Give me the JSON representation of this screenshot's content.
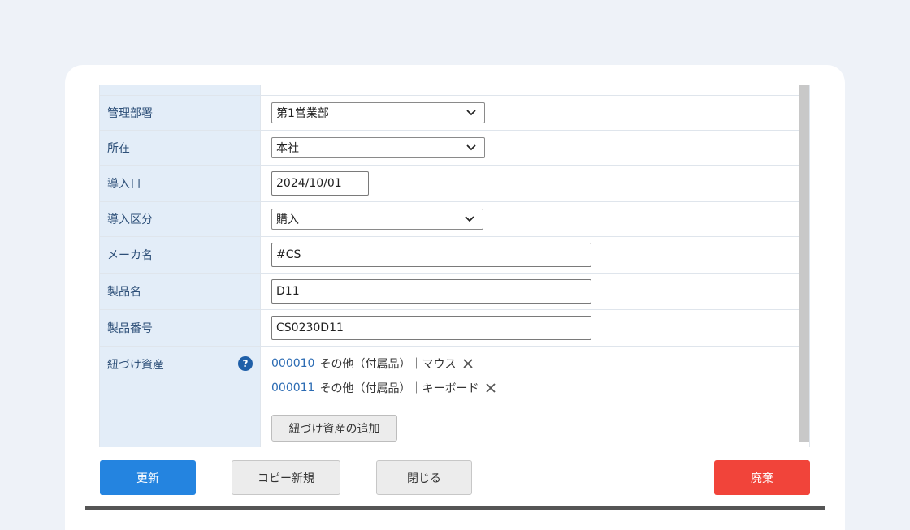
{
  "form": {
    "department": {
      "label": "管理部署",
      "value": "第1営業部"
    },
    "location": {
      "label": "所在",
      "value": "本社"
    },
    "intro_date": {
      "label": "導入日",
      "value": "2024/10/01"
    },
    "intro_type": {
      "label": "導入区分",
      "value": "購入"
    },
    "maker": {
      "label": "メーカ名",
      "value": "#CS"
    },
    "product_name": {
      "label": "製品名",
      "value": "D11"
    },
    "product_number": {
      "label": "製品番号",
      "value": "CS0230D11"
    },
    "linked_assets": {
      "label": "紐づけ資産",
      "help_icon": "?",
      "items": [
        {
          "code": "000010",
          "text": "その他（付属品）｜マウス"
        },
        {
          "code": "000011",
          "text": "その他（付属品）｜キーボード"
        }
      ],
      "add_label": "紐づけ資産の追加"
    }
  },
  "actions": {
    "update": "更新",
    "copy_new": "コピー新規",
    "close": "閉じる",
    "discard": "廃棄"
  },
  "colors": {
    "label_bg": "#e3edf8",
    "label_text": "#2d4f78",
    "primary": "#2484e0",
    "danger": "#f1443a",
    "link": "#2b6bb3"
  }
}
